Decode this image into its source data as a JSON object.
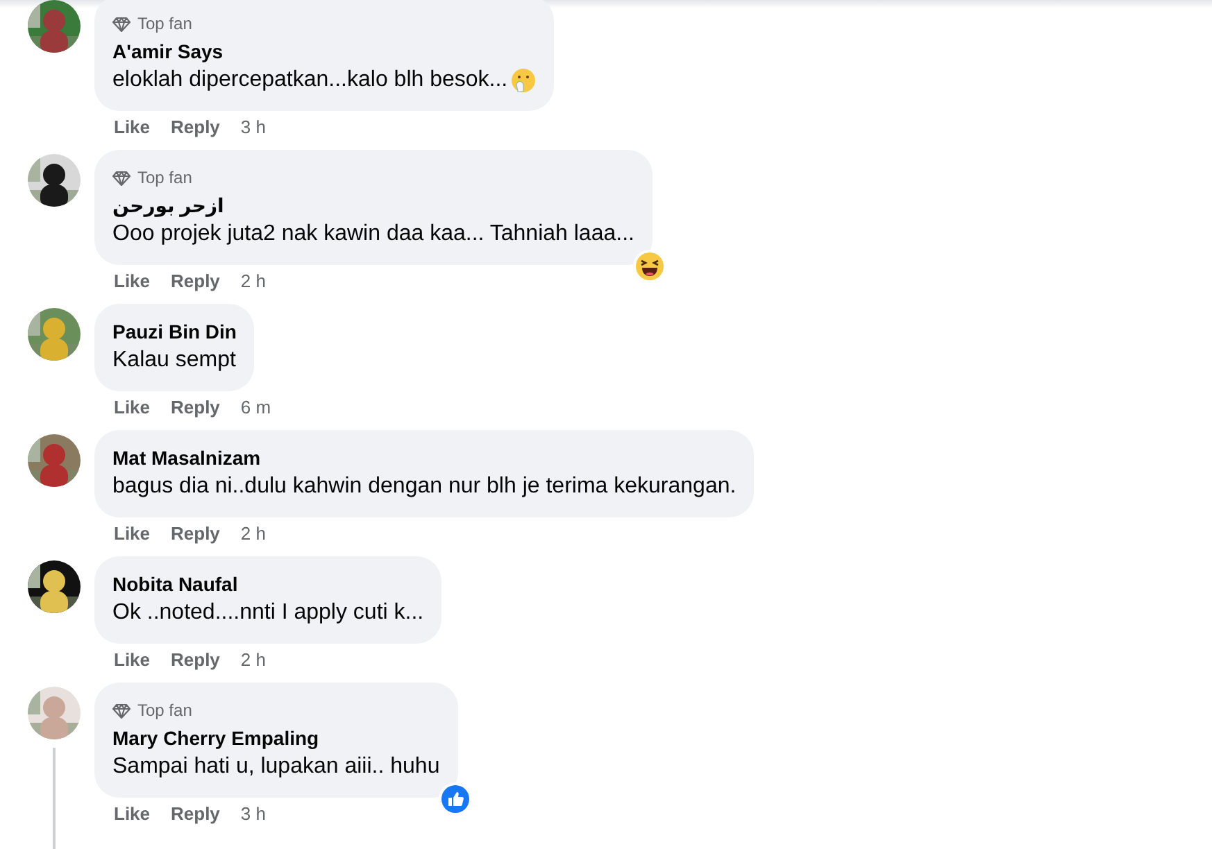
{
  "comments": [
    {
      "top_fan": "Top fan",
      "name": "A'amir Says",
      "text": "eloklah dipercepatkan...kalo blh besok...",
      "end_emoji": {
        "kind": "hand-over-mouth"
      },
      "actions": [
        "Like",
        "Reply"
      ],
      "time": "3 h",
      "has_replies": false
    },
    {
      "top_fan": "Top fan",
      "name": "ازحر بورحن",
      "text": "Ooo projek juta2 nak kawin daa kaa... Tahniah laaa...",
      "reaction": {
        "kind": "haha"
      },
      "actions": [
        "Like",
        "Reply"
      ],
      "time": "2 h",
      "has_replies": false
    },
    {
      "name": "Pauzi Bin Din",
      "text": "Kalau sempt",
      "actions": [
        "Like",
        "Reply"
      ],
      "time": "6 m",
      "has_replies": false
    },
    {
      "name": "Mat Masalnizam",
      "text": "bagus dia ni..dulu kahwin dengan nur blh je terima kekurangan.",
      "actions": [
        "Like",
        "Reply"
      ],
      "time": "2 h",
      "has_replies": false
    },
    {
      "name": "Nobita Naufal",
      "text": "Ok ..noted....nnti I apply cuti k...",
      "actions": [
        "Like",
        "Reply"
      ],
      "time": "2 h",
      "has_replies": false
    },
    {
      "top_fan": "Top fan",
      "name": "Mary Cherry Empaling",
      "text": "Sampai hati u, lupakan aiii.. huhu",
      "reaction": {
        "kind": "like"
      },
      "actions": [
        "Like",
        "Reply"
      ],
      "time": "3 h",
      "has_replies": true
    }
  ]
}
